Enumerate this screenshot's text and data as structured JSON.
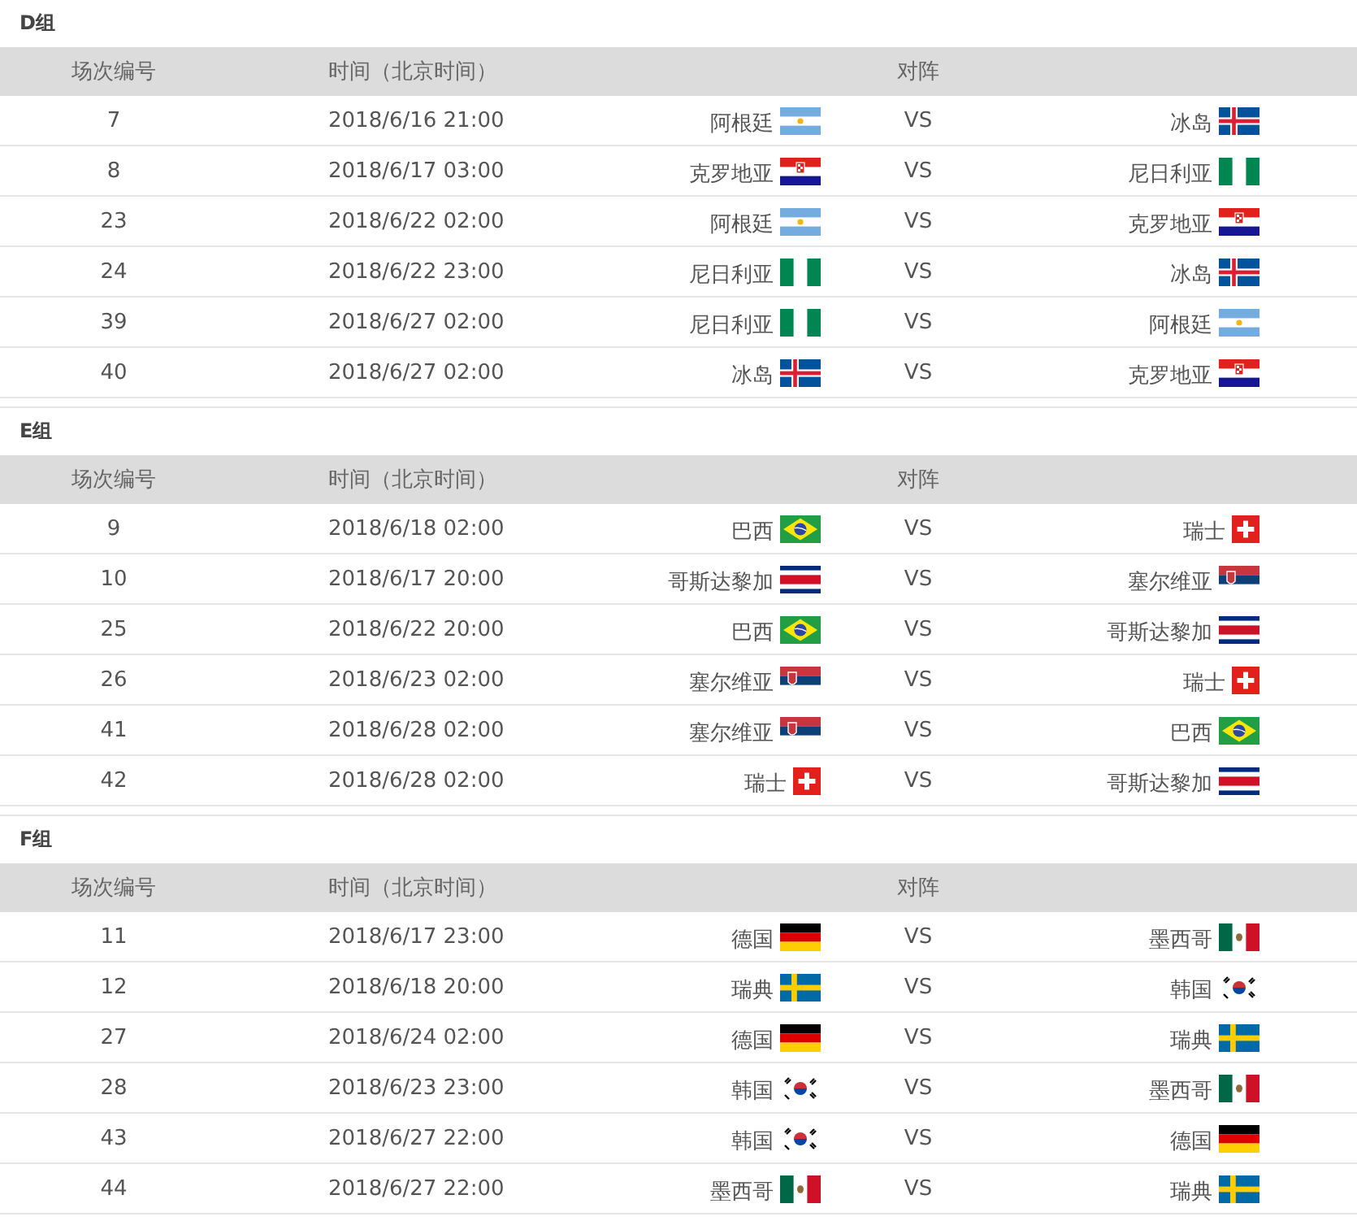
{
  "groups": [
    {
      "title": "D组",
      "columns": [
        "场次编号",
        "时间（北京时间）",
        "对阵"
      ],
      "matches": [
        {
          "number": "7",
          "time": "2018/6/16 21:00",
          "home": {
            "name": "阿根廷",
            "kind": "ar"
          },
          "vs": "VS",
          "away": {
            "name": "冰岛",
            "kind": "is"
          }
        },
        {
          "number": "8",
          "time": "2018/6/17 03:00",
          "home": {
            "name": "克罗地亚",
            "kind": "hr"
          },
          "vs": "VS",
          "away": {
            "name": "尼日利亚",
            "kind": "ng"
          }
        },
        {
          "number": "23",
          "time": "2018/6/22 02:00",
          "home": {
            "name": "阿根廷",
            "kind": "ar"
          },
          "vs": "VS",
          "away": {
            "name": "克罗地亚",
            "kind": "hr"
          }
        },
        {
          "number": "24",
          "time": "2018/6/22 23:00",
          "home": {
            "name": "尼日利亚",
            "kind": "ng"
          },
          "vs": "VS",
          "away": {
            "name": "冰岛",
            "kind": "is"
          }
        },
        {
          "number": "39",
          "time": "2018/6/27 02:00",
          "home": {
            "name": "尼日利亚",
            "kind": "ng"
          },
          "vs": "VS",
          "away": {
            "name": "阿根廷",
            "kind": "ar"
          }
        },
        {
          "number": "40",
          "time": "2018/6/27 02:00",
          "home": {
            "name": "冰岛",
            "kind": "is"
          },
          "vs": "VS",
          "away": {
            "name": "克罗地亚",
            "kind": "hr"
          }
        }
      ]
    },
    {
      "title": "E组",
      "columns": [
        "场次编号",
        "时间（北京时间）",
        "对阵"
      ],
      "matches": [
        {
          "number": "9",
          "time": "2018/6/18 02:00",
          "home": {
            "name": "巴西",
            "kind": "br"
          },
          "vs": "VS",
          "away": {
            "name": "瑞士",
            "kind": "ch"
          }
        },
        {
          "number": "10",
          "time": "2018/6/17 20:00",
          "home": {
            "name": "哥斯达黎加",
            "kind": "cr"
          },
          "vs": "VS",
          "away": {
            "name": "塞尔维亚",
            "kind": "rs"
          }
        },
        {
          "number": "25",
          "time": "2018/6/22 20:00",
          "home": {
            "name": "巴西",
            "kind": "br"
          },
          "vs": "VS",
          "away": {
            "name": "哥斯达黎加",
            "kind": "cr"
          }
        },
        {
          "number": "26",
          "time": "2018/6/23 02:00",
          "home": {
            "name": "塞尔维亚",
            "kind": "rs"
          },
          "vs": "VS",
          "away": {
            "name": "瑞士",
            "kind": "ch"
          }
        },
        {
          "number": "41",
          "time": "2018/6/28 02:00",
          "home": {
            "name": "塞尔维亚",
            "kind": "rs"
          },
          "vs": "VS",
          "away": {
            "name": "巴西",
            "kind": "br"
          }
        },
        {
          "number": "42",
          "time": "2018/6/28 02:00",
          "home": {
            "name": "瑞士",
            "kind": "ch"
          },
          "vs": "VS",
          "away": {
            "name": "哥斯达黎加",
            "kind": "cr"
          }
        }
      ]
    },
    {
      "title": "F组",
      "columns": [
        "场次编号",
        "时间（北京时间）",
        "对阵"
      ],
      "matches": [
        {
          "number": "11",
          "time": "2018/6/17 23:00",
          "home": {
            "name": "德国",
            "kind": "de"
          },
          "vs": "VS",
          "away": {
            "name": "墨西哥",
            "kind": "mx"
          }
        },
        {
          "number": "12",
          "time": "2018/6/18 20:00",
          "home": {
            "name": "瑞典",
            "kind": "se"
          },
          "vs": "VS",
          "away": {
            "name": "韩国",
            "kind": "kr"
          }
        },
        {
          "number": "27",
          "time": "2018/6/24 02:00",
          "home": {
            "name": "德国",
            "kind": "de"
          },
          "vs": "VS",
          "away": {
            "name": "瑞典",
            "kind": "se"
          }
        },
        {
          "number": "28",
          "time": "2018/6/23 23:00",
          "home": {
            "name": "韩国",
            "kind": "kr"
          },
          "vs": "VS",
          "away": {
            "name": "墨西哥",
            "kind": "mx"
          }
        },
        {
          "number": "43",
          "time": "2018/6/27 22:00",
          "home": {
            "name": "韩国",
            "kind": "kr"
          },
          "vs": "VS",
          "away": {
            "name": "德国",
            "kind": "de"
          }
        },
        {
          "number": "44",
          "time": "2018/6/27 22:00",
          "home": {
            "name": "墨西哥",
            "kind": "mx"
          },
          "vs": "VS",
          "away": {
            "name": "瑞典",
            "kind": "se"
          }
        }
      ]
    }
  ]
}
